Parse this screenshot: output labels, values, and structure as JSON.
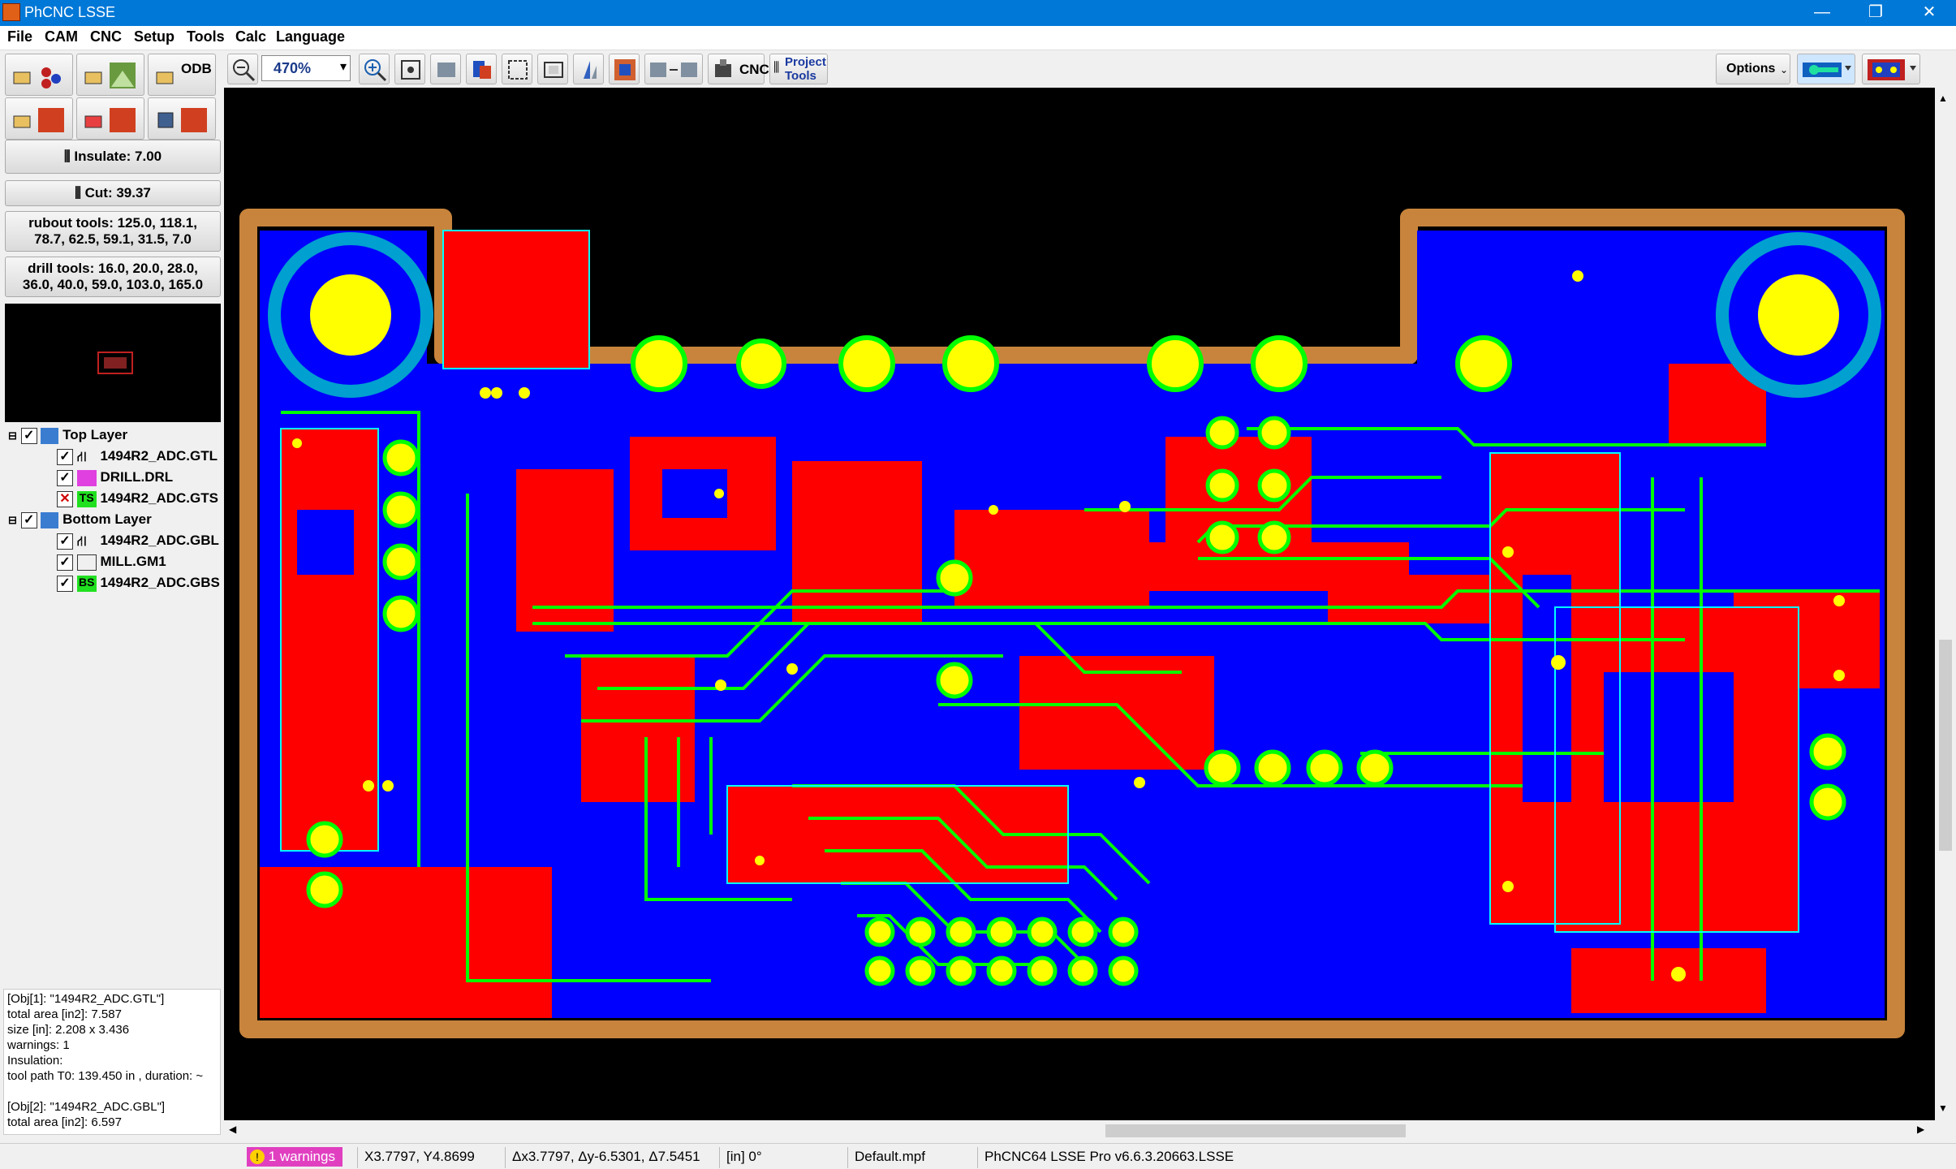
{
  "window": {
    "title": "PhCNC LSSE",
    "minimize": "—",
    "restore": "❐",
    "close": "✕"
  },
  "menu": [
    "File",
    "CAM",
    "CNC",
    "Setup",
    "Tools",
    "Calc",
    "Language"
  ],
  "toolbar": {
    "zoom_value": "470%",
    "cnc_label": "CNC",
    "project_tools_line1": "Project",
    "project_tools_line2": "Tools",
    "options_label": "Options",
    "odb_label": "ODB"
  },
  "tools": {
    "insulate": "Insulate: 7.00",
    "cut": "Cut: 39.37",
    "rubout_line1": "rubout tools: 125.0, 118.1,",
    "rubout_line2": "78.7, 62.5, 59.1, 31.5, 7.0",
    "drill_line1": "drill tools: 16.0, 20.0, 28.0,",
    "drill_line2": "36.0, 40.0, 59.0, 103.0, 165.0"
  },
  "layers": {
    "top_layer": "Top Layer",
    "top_files": [
      {
        "name": "1494R2_ADC.GTL",
        "badge": "",
        "checked": "✓"
      },
      {
        "name": "DRILL.DRL",
        "badge": "",
        "checked": "✓"
      },
      {
        "name": "1494R2_ADC.GTS",
        "badge": "TS",
        "checked": "✕"
      }
    ],
    "bottom_layer": "Bottom Layer",
    "bottom_files": [
      {
        "name": "1494R2_ADC.GBL",
        "badge": "",
        "checked": "✓"
      },
      {
        "name": "MILL.GM1",
        "badge": "",
        "checked": "✓"
      },
      {
        "name": "1494R2_ADC.GBS",
        "badge": "BS",
        "checked": "✓"
      }
    ]
  },
  "info": {
    "l1": "[Obj[1]: \"1494R2_ADC.GTL\"]",
    "l2": "total area [in2]: 7.587",
    "l3": "size [in]: 2.208 x 3.436",
    "l4": "warnings: 1",
    "l5": "Insulation:",
    "l6": "tool path T0: 139.450 in , duration: ~",
    "l7": "",
    "l8": "[Obj[2]: \"1494R2_ADC.GBL\"]",
    "l9": "total area [in2]: 6.597"
  },
  "status": {
    "warnings": "1 warnings",
    "coords": "X3.7797, Y4.8699",
    "delta": "Δx3.7797, Δy-6.5301, Δ7.5451",
    "units": "[in]  0°",
    "machine": "Default.mpf",
    "version": "PhCNC64 LSSE Pro v6.6.3.20663.LSSE"
  },
  "colors": {
    "titlebar": "#0078d7",
    "top_copper": "#ff0000",
    "bottom_copper": "#0000ff",
    "isolation": "#00ff00",
    "pads": "#ffff00",
    "board_outline": "#c8843c",
    "canvas": "#000000"
  }
}
